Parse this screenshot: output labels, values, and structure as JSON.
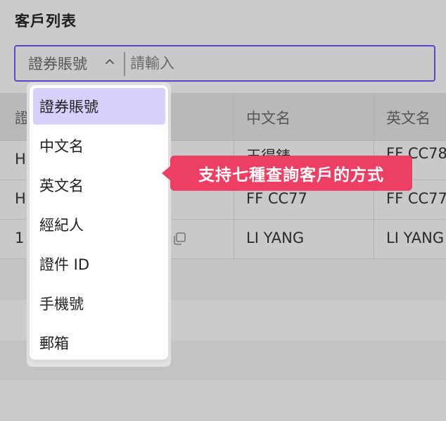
{
  "page": {
    "title": "客戶列表"
  },
  "search": {
    "selected_field": "證券賬號",
    "placeholder": "請輸入",
    "accent_color": "#5b45c8"
  },
  "dropdown": {
    "options": [
      "證券賬號",
      "中文名",
      "英文名",
      "經紀人",
      "證件 ID",
      "手機號",
      "郵箱"
    ],
    "selected_index": 0,
    "selected_color": "#d7d0fb"
  },
  "table": {
    "headers": [
      "證",
      "中文名",
      "英文名"
    ],
    "rows": [
      {
        "c1": "H",
        "cn": "王得錶",
        "en": "FF CC78"
      },
      {
        "c1": "H",
        "cn": "FF CC77",
        "en": "FF CC77"
      },
      {
        "c1": "1",
        "cn": "LI YANG",
        "en": "LI YANG"
      }
    ]
  },
  "tooltip": {
    "text": "支持七種查詢客戶的方式",
    "color": "#ec3f63"
  },
  "icons": [
    "chevron-up-icon",
    "copy-icon"
  ]
}
